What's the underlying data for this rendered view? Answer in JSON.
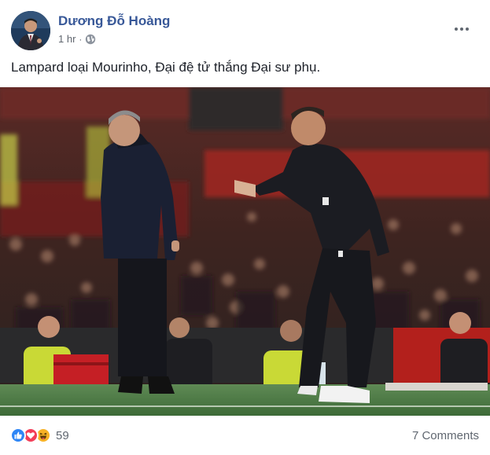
{
  "post": {
    "author": "Dương Đỗ Hoàng",
    "time": "1 hr",
    "separator": "·",
    "privacy_icon": "globe-icon",
    "more_icon": "more-options-icon",
    "caption": "Lampard loại Mourinho, Đại đệ tử thắng Đại sư phụ."
  },
  "photo": {
    "description_icon": "photo"
  },
  "footer": {
    "reaction_icons": [
      "like-icon",
      "love-icon",
      "haha-icon"
    ],
    "reaction_count": "59",
    "comments_label": "7 Comments"
  },
  "colors": {
    "author_link": "#385898",
    "meta_text": "#616770",
    "like": "#2e86f6",
    "love": "#f33e58",
    "haha": "#f7b125"
  }
}
